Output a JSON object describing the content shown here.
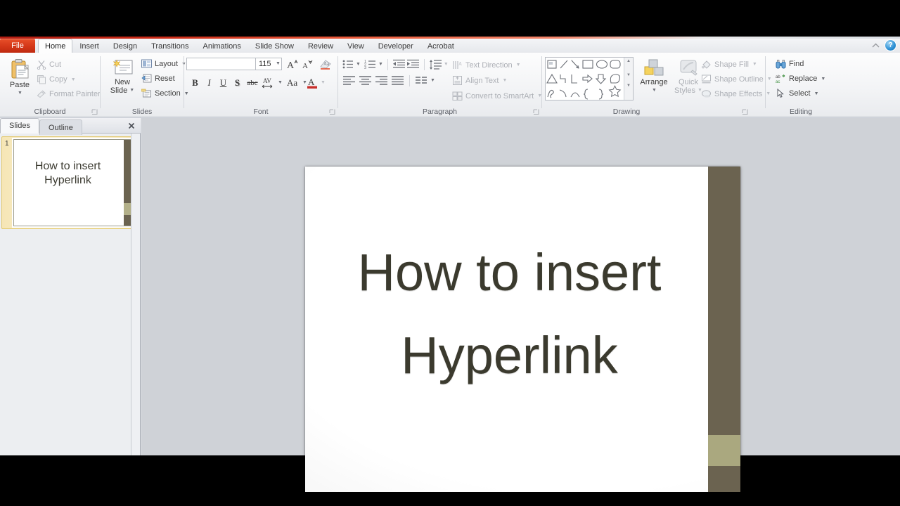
{
  "window": {
    "file_tab": "File",
    "tabs": [
      "Home",
      "Insert",
      "Design",
      "Transitions",
      "Animations",
      "Slide Show",
      "Review",
      "View",
      "Developer",
      "Acrobat"
    ],
    "active_tab": "Home",
    "minimize_ribbon_icon": "chevron-up-icon",
    "help_label": "?"
  },
  "ribbon": {
    "clipboard": {
      "label": "Clipboard",
      "paste": "Paste",
      "paste_icon": "clipboard-icon",
      "cut": "Cut",
      "cut_icon": "scissors-icon",
      "copy": "Copy",
      "copy_icon": "copy-icon",
      "format_painter": "Format Painter",
      "format_painter_icon": "paintbrush-icon",
      "dialog_launcher_icon": "dialog-launcher-icon"
    },
    "slides": {
      "label": "Slides",
      "new_slide": "New\nSlide",
      "new_slide_line1": "New",
      "new_slide_line2": "Slide",
      "new_slide_icon": "new-slide-icon",
      "layout": "Layout",
      "layout_icon": "layout-icon",
      "reset": "Reset",
      "reset_icon": "reset-icon",
      "section": "Section",
      "section_icon": "section-icon"
    },
    "font": {
      "label": "Font",
      "font_name_value": "",
      "font_name_placeholder": "",
      "font_size_value": "115",
      "bold": "B",
      "italic": "I",
      "underline": "U",
      "shadow": "S",
      "strikethrough": "abc",
      "character_spacing_icon": "character-spacing-icon",
      "change_case_icon": "change-case-icon",
      "font_color_icon": "font-color-icon",
      "clear_formatting_icon": "clear-formatting-icon",
      "grow_font_icon": "grow-font-icon",
      "shrink_font_icon": "shrink-font-icon",
      "dialog_launcher_icon": "dialog-launcher-icon"
    },
    "paragraph": {
      "label": "Paragraph",
      "bullets_icon": "bullets-icon",
      "numbering_icon": "numbering-icon",
      "decrease_indent_icon": "decrease-indent-icon",
      "increase_indent_icon": "increase-indent-icon",
      "line_spacing_icon": "line-spacing-icon",
      "align_left_icon": "align-left-icon",
      "align_center_icon": "align-center-icon",
      "align_right_icon": "align-right-icon",
      "justify_icon": "justify-icon",
      "columns_icon": "columns-icon",
      "text_direction": "Text Direction",
      "text_direction_icon": "text-direction-icon",
      "align_text": "Align Text",
      "align_text_icon": "align-text-icon",
      "convert_to_smartart": "Convert to SmartArt",
      "convert_to_smartart_icon": "smartart-icon",
      "dialog_launcher_icon": "dialog-launcher-icon"
    },
    "drawing": {
      "label": "Drawing",
      "shapes_gallery_icon": "shapes-gallery-icon",
      "arrange": "Arrange",
      "arrange_icon": "arrange-icon",
      "quick_styles_line1": "Quick",
      "quick_styles_line2": "Styles",
      "quick_styles_icon": "quick-styles-icon",
      "shape_fill": "Shape Fill",
      "shape_fill_icon": "shape-fill-icon",
      "shape_outline": "Shape Outline",
      "shape_outline_icon": "shape-outline-icon",
      "shape_effects": "Shape Effects",
      "shape_effects_icon": "shape-effects-icon",
      "dialog_launcher_icon": "dialog-launcher-icon"
    },
    "editing": {
      "label": "Editing",
      "find": "Find",
      "find_icon": "binoculars-icon",
      "replace": "Replace",
      "replace_icon": "replace-icon",
      "select": "Select",
      "select_icon": "cursor-icon"
    }
  },
  "slides_panel": {
    "tab_slides": "Slides",
    "tab_outline": "Outline",
    "active_tab": "Slides",
    "close_icon": "close-icon",
    "thumbnails": [
      {
        "number": "1",
        "title_line1": "How to insert",
        "title_line2": "Hyperlink",
        "selected": true
      }
    ]
  },
  "slide": {
    "title_line1": "How to insert",
    "title_line2": "Hyperlink",
    "title_color": "#3b3a2e",
    "accent_dark": "#6b6350",
    "accent_light": "#aaa87f",
    "background": "#ffffff"
  }
}
